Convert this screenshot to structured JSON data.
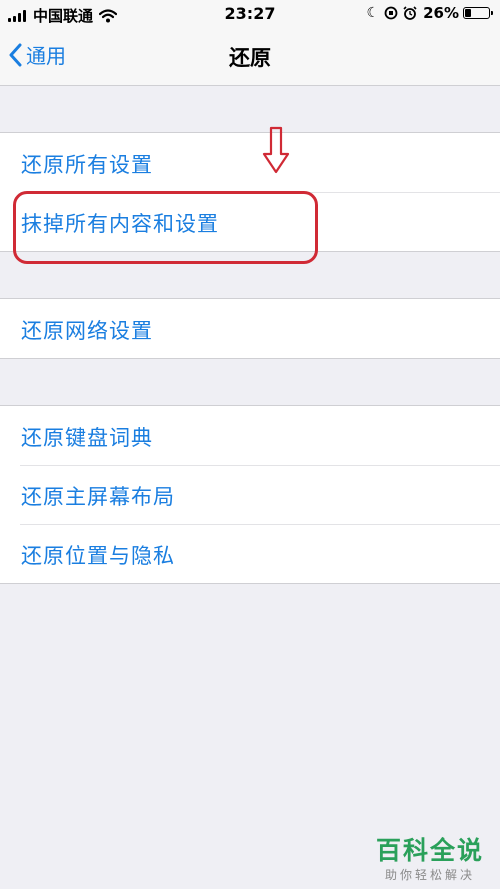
{
  "status_bar": {
    "carrier": "中国联通",
    "time": "23:27",
    "battery": "26%",
    "battery_level": 0.26,
    "icons": [
      "signal-icon",
      "wifi-icon",
      "moon-icon",
      "orientation-lock-icon",
      "alarm-icon",
      "battery-icon"
    ]
  },
  "nav": {
    "back_label": "通用",
    "title": "还原"
  },
  "groups": [
    {
      "items": [
        "还原所有设置",
        "抹掉所有内容和设置"
      ]
    },
    {
      "items": [
        "还原网络设置"
      ]
    },
    {
      "items": [
        "还原键盘词典",
        "还原主屏幕布局",
        "还原位置与隐私"
      ]
    }
  ],
  "annotation": {
    "highlight_color": "#d02a35"
  },
  "watermark": {
    "title": "百科全说",
    "subtitle": "助你轻松解决"
  },
  "colors": {
    "accent": "#1a7ee0",
    "background": "#efeff4"
  }
}
